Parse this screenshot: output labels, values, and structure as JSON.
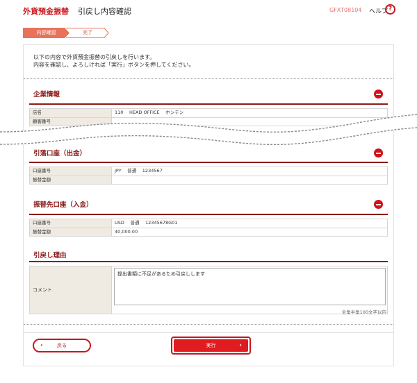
{
  "header": {
    "app_title": "外貨預金振替",
    "page_title": "引戻し内容確認",
    "screen_id": "GFXT08104",
    "help_label": "ヘルプ",
    "help_icon_text": "?"
  },
  "steps": [
    {
      "label": "内容確認"
    },
    {
      "label": "完了"
    }
  ],
  "intro": {
    "line1": "以下の内容で外貨預金振替の引戻しを行います。",
    "line2": "内容を確認し、よろしければ「実行」ボタンを押してください。"
  },
  "sections": {
    "company": {
      "title": "企業情報",
      "rows": [
        {
          "label": "店名",
          "value": "110　 HEAD OFFICE　 ホンテン"
        },
        {
          "label": "顧客番号",
          "value": ""
        }
      ]
    },
    "withdrawal": {
      "title": "引落口座（出金）",
      "rows": [
        {
          "label": "口座番号",
          "value": "JPY　 普通　 1234567"
        },
        {
          "label": "振替金額",
          "value": ""
        }
      ]
    },
    "deposit": {
      "title": "振替先口座（入金）",
      "rows": [
        {
          "label": "口座番号",
          "value": "USD　 普通　 12345678G01"
        },
        {
          "label": "振替金額",
          "value": "40,000.00"
        }
      ]
    },
    "reason": {
      "title": "引戻し理由",
      "comment_label": "コメント",
      "comment_value": "提出書類に不足があるため引戻しします",
      "char_limit": "全角半角100文字以内"
    }
  },
  "buttons": {
    "back": "戻る",
    "execute": "実行"
  },
  "colors": {
    "brand_red": "#c8161d",
    "section_title": "#8b1a1a",
    "label_bg": "#efeae2"
  }
}
